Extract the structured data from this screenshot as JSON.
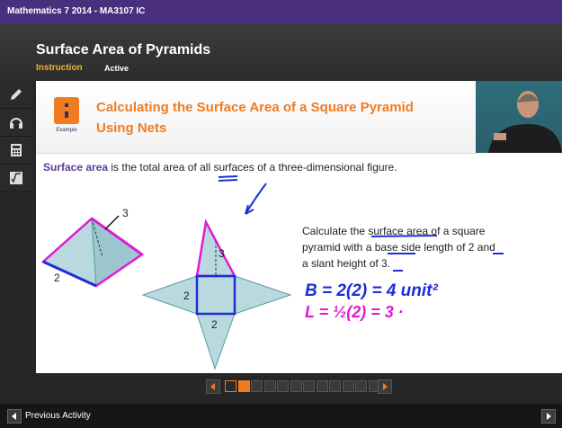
{
  "course": {
    "title": "Mathematics 7 2014 - MA3107 IC"
  },
  "lesson": {
    "title": "Surface Area of Pyramids",
    "tab_instruction": "Instruction",
    "tab_active": "Active"
  },
  "tools": [
    {
      "icon": "pencil-icon"
    },
    {
      "icon": "headphones-icon"
    },
    {
      "icon": "calculator-icon"
    },
    {
      "icon": "formula-icon"
    }
  ],
  "slide": {
    "badge_label": "Example",
    "heading_line1": "Calculating the Surface Area of a Square Pyramid",
    "heading_line2": "Using Nets",
    "def_term": "Surface area",
    "def_rest": " is the total area of all surfaces of a three-dimensional figure.",
    "problem_line1": "Calculate the surface area of a square",
    "problem_line2": "pyramid with a base side length of 2 and",
    "problem_line3": "a slant height of 3.",
    "pyramid_label_slant": "3",
    "pyramid_label_base": "2",
    "net_label_slant": "3",
    "net_label_left": "2",
    "net_label_bottom": "2",
    "ink_line1": "B = 2(2) = 4 unit²",
    "ink_line2": "L = ½(2) = 3 ·"
  },
  "colors": {
    "accent": "#f07c22",
    "brand": "#4a2f7f",
    "ink_blue": "#1c2fd6",
    "ink_pink": "#e01bd4",
    "net_fill": "#b9d9de"
  },
  "pager": {
    "total": 12,
    "current_index": 1,
    "visited_index": 0
  },
  "footer": {
    "previous_label": "Previous Activity"
  }
}
